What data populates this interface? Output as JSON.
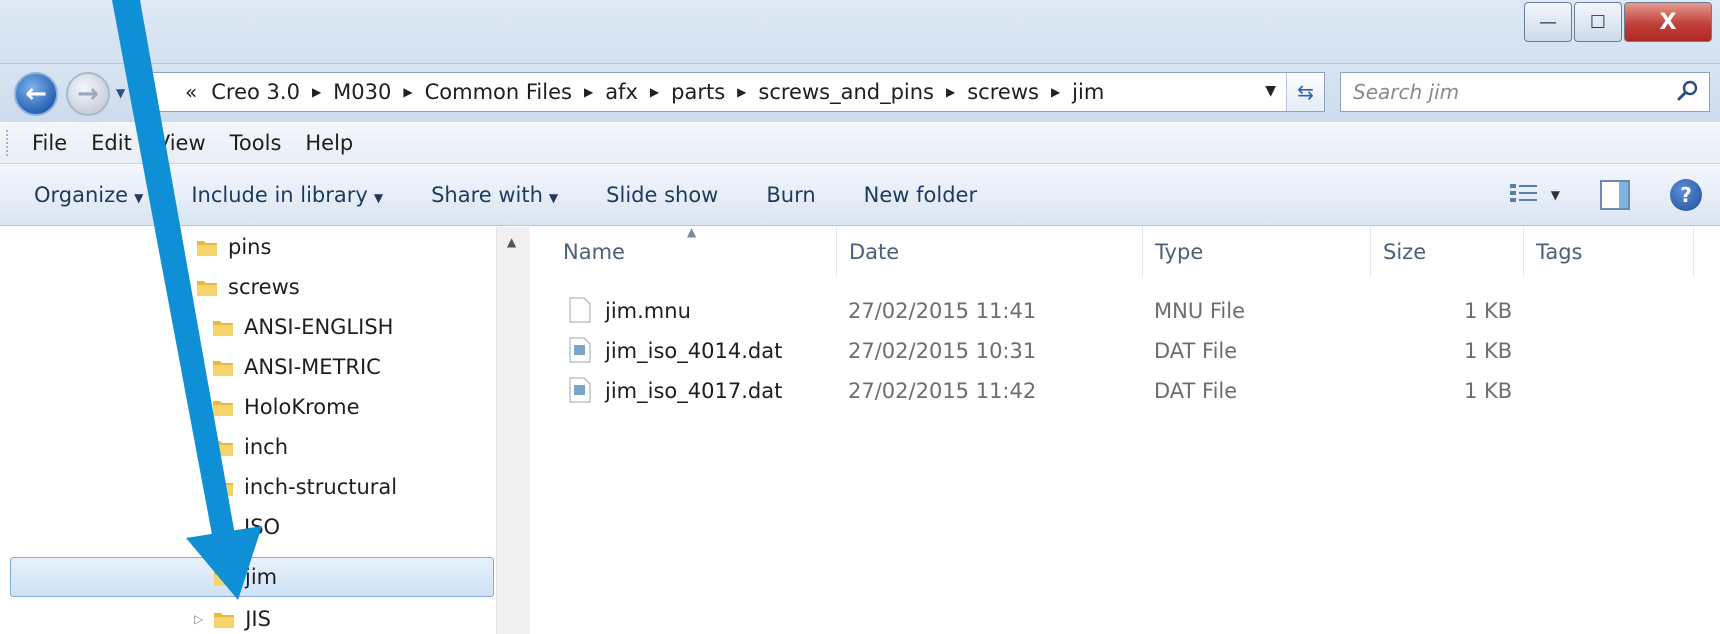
{
  "window": {
    "minimize": "—",
    "maximize": "☐",
    "close": "X"
  },
  "nav": {
    "back_glyph": "←",
    "forward_glyph": "→",
    "overflow": "«",
    "breadcrumbs": [
      "Creo 3.0",
      "M030",
      "Common Files",
      "afx",
      "parts",
      "screws_and_pins",
      "screws",
      "jim"
    ],
    "search_placeholder": "Search jim"
  },
  "menu": {
    "items": [
      "File",
      "Edit",
      "View",
      "Tools",
      "Help"
    ]
  },
  "toolbar": {
    "organize": "Organize",
    "include_in_library": "Include in library",
    "share_with": "Share with",
    "slide_show": "Slide show",
    "burn": "Burn",
    "new_folder": "New folder",
    "help": "?"
  },
  "tree": {
    "items": [
      {
        "label": "pins",
        "level": 0,
        "selected": false,
        "expander": ""
      },
      {
        "label": "screws",
        "level": 0,
        "selected": false,
        "expander": ""
      },
      {
        "label": "ANSI-ENGLISH",
        "level": 1,
        "selected": false,
        "expander": ""
      },
      {
        "label": "ANSI-METRIC",
        "level": 1,
        "selected": false,
        "expander": ""
      },
      {
        "label": "HoloKrome",
        "level": 1,
        "selected": false,
        "expander": ""
      },
      {
        "label": "inch",
        "level": 1,
        "selected": false,
        "expander": ""
      },
      {
        "label": "inch-structural",
        "level": 1,
        "selected": false,
        "expander": ""
      },
      {
        "label": "ISO",
        "level": 1,
        "selected": false,
        "expander": ""
      },
      {
        "label": "jim",
        "level": 1,
        "selected": true,
        "expander": ""
      },
      {
        "label": "JIS",
        "level": 1,
        "selected": false,
        "expander": "▷"
      }
    ]
  },
  "columns": {
    "name": "Name",
    "date": "Date",
    "type": "Type",
    "size": "Size",
    "tags": "Tags"
  },
  "files": [
    {
      "name": "jim.mnu",
      "date": "27/02/2015 11:41",
      "type": "MNU File",
      "size": "1 KB",
      "icon": "generic-file-icon"
    },
    {
      "name": "jim_iso_4014.dat",
      "date": "27/02/2015 10:31",
      "type": "DAT File",
      "size": "1 KB",
      "icon": "dat-file-icon"
    },
    {
      "name": "jim_iso_4017.dat",
      "date": "27/02/2015 11:42",
      "type": "DAT File",
      "size": "1 KB",
      "icon": "dat-file-icon"
    }
  ],
  "colors": {
    "annotation_arrow": "#0e8fd6",
    "folder": "#e8b93a",
    "selection": "#cfe3f7"
  }
}
